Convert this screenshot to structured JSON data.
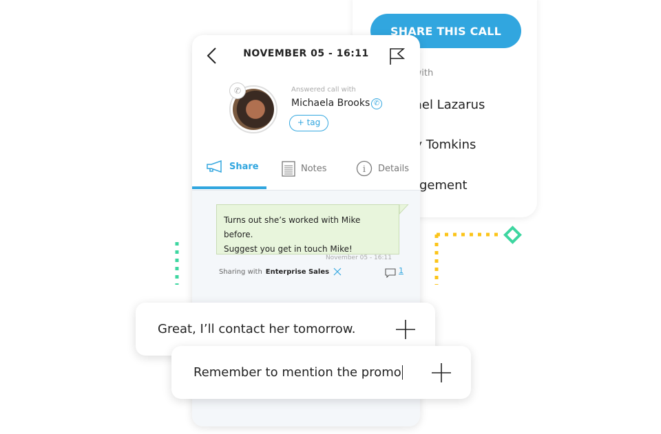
{
  "share_panel": {
    "button": "SHARE THIS CALL",
    "share_with_label": "Share with",
    "people": [
      "Michael Lazarus",
      "Cassy Tomkins",
      "Management"
    ]
  },
  "call": {
    "datetime": "NOVEMBER 05 - 16:11",
    "answered_label": "Answered call with",
    "contact": "Michaela Brooks",
    "tag_button": "+ tag"
  },
  "tabs": [
    {
      "label": "Share",
      "icon": "megaphone-icon",
      "active": true
    },
    {
      "label": "Notes",
      "icon": "notepad-icon"
    },
    {
      "label": "Details",
      "icon": "info-icon"
    }
  ],
  "message": {
    "text_line1": "Turns out she’s worked with Mike before.",
    "text_line2": "Suggest you get in touch Mike!",
    "timestamp": "November 05 - 16:11"
  },
  "sharing": {
    "label": "Sharing with",
    "group": "Enterprise Sales",
    "comment_count": "1"
  },
  "inputs": [
    {
      "value": "Great, I’ll contact her tomorrow."
    },
    {
      "value": "Remember to mention the promo"
    }
  ],
  "colors": {
    "accent": "#31a6df",
    "bubble": "#e8f5dc",
    "teal": "#3dd6a0",
    "yellow": "#fcc419"
  }
}
